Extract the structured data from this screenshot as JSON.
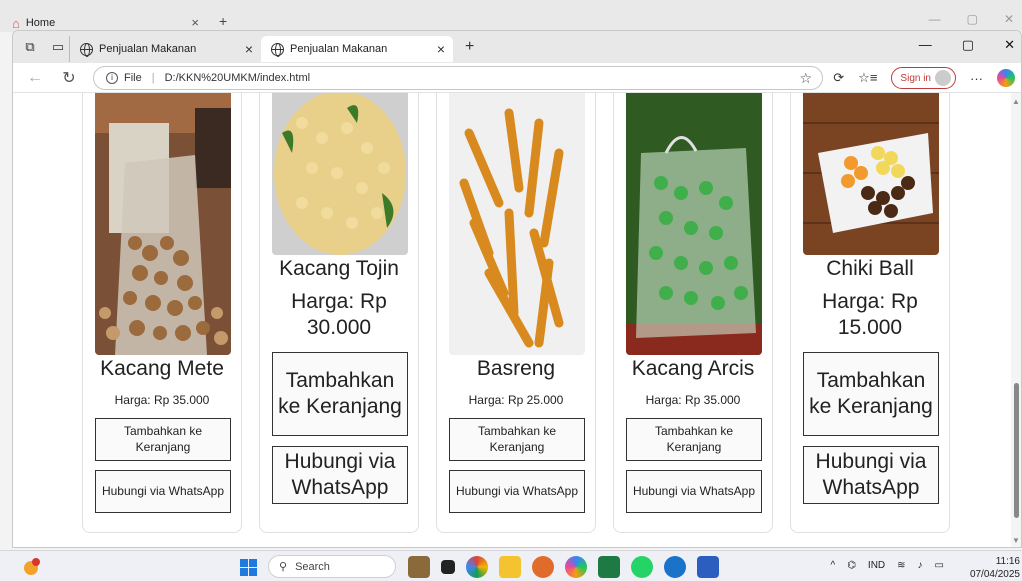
{
  "backdrop": {
    "tab_title": "Home",
    "close_glyph": "×",
    "newtab_glyph": "+",
    "window_controls": [
      "—",
      "▢",
      "✕"
    ]
  },
  "browser": {
    "tabs": [
      {
        "title": "Penjualan Makanan",
        "active": false
      },
      {
        "title": "Penjualan Makanan",
        "active": true
      }
    ],
    "close_glyph": "×",
    "newtab_glyph": "+",
    "window_controls": [
      "—",
      "▢",
      "✕"
    ],
    "url_scheme": "File",
    "url": "D:/KKN%20UMKM/index.html",
    "signin_label": "Sign in",
    "more_glyph": "···"
  },
  "products": [
    {
      "name": "Kacang Mete",
      "price": "Harga: Rp 35.000",
      "cart_label": "Tambahkan ke Keranjang",
      "wa_label": "Hubungi via WhatsApp",
      "size": "small"
    },
    {
      "name": "Kacang Tojin",
      "price": "Harga: Rp 30.000",
      "cart_label": "Tambahkan ke Keranjang",
      "wa_label": "Hubungi via WhatsApp",
      "size": "large"
    },
    {
      "name": "Basreng",
      "price": "Harga: Rp 25.000",
      "cart_label": "Tambahkan ke Keranjang",
      "wa_label": "Hubungi via WhatsApp",
      "size": "small"
    },
    {
      "name": "Kacang Arcis",
      "price": "Harga: Rp 35.000",
      "cart_label": "Tambahkan ke Keranjang",
      "wa_label": "Hubungi via WhatsApp",
      "size": "small"
    },
    {
      "name": "Chiki Ball",
      "price": "Harga: Rp 15.000",
      "cart_label": "Tambahkan ke Keranjang",
      "wa_label": "Hubungi via WhatsApp",
      "size": "large"
    }
  ],
  "taskbar": {
    "search_placeholder": "Search",
    "language": "IND",
    "time": "11:16",
    "date": "07/04/2025"
  },
  "colors": {
    "accent_signin": "#c03a3a",
    "windows_blue": "#1f7ae0"
  }
}
